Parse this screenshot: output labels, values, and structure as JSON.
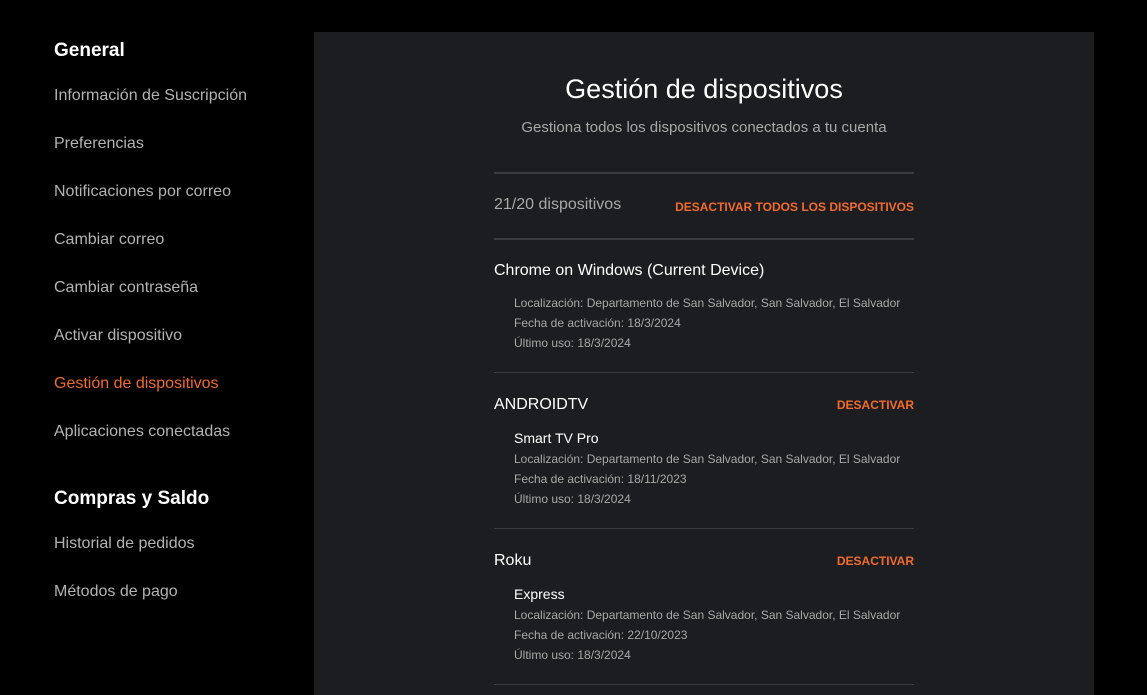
{
  "sidebar": {
    "general_title": "General",
    "general_items": [
      "Información de Suscripción",
      "Preferencias",
      "Notificaciones por correo",
      "Cambiar correo",
      "Cambiar contraseña",
      "Activar dispositivo",
      "Gestión de dispositivos",
      "Aplicaciones conectadas"
    ],
    "active_item": "Gestión de dispositivos",
    "purchases_title": "Compras y Saldo",
    "purchases_items": [
      "Historial de pedidos",
      "Métodos de pago"
    ]
  },
  "main": {
    "title": "Gestión de dispositivos",
    "subtitle": "Gestiona todos los dispositivos conectados a tu cuenta",
    "device_count": "21/20 dispositivos",
    "deactivate_all": "DESACTIVAR TODOS LOS DISPOSITIVOS",
    "devices": [
      {
        "name": "Chrome on Windows (Current Device)",
        "model": "",
        "location": "Localización: Departamento de San Salvador, San Salvador, El Salvador",
        "activation": "Fecha de activación: 18/3/2024",
        "last_use": "Último uso: 18/3/2024",
        "action": ""
      },
      {
        "name": "ANDROIDTV",
        "model": "Smart TV Pro",
        "location": "Localización: Departamento de San Salvador, San Salvador, El Salvador",
        "activation": "Fecha de activación: 18/11/2023",
        "last_use": "Último uso: 18/3/2024",
        "action": "DESACTIVAR"
      },
      {
        "name": "Roku",
        "model": "Express",
        "location": "Localización: Departamento de San Salvador, San Salvador, El Salvador",
        "activation": "Fecha de activación: 22/10/2023",
        "last_use": "Último uso: 18/3/2024",
        "action": "DESACTIVAR"
      }
    ]
  },
  "colors": {
    "accent": "#f26b2a",
    "background": "#000000",
    "panel": "#1c1d20"
  }
}
